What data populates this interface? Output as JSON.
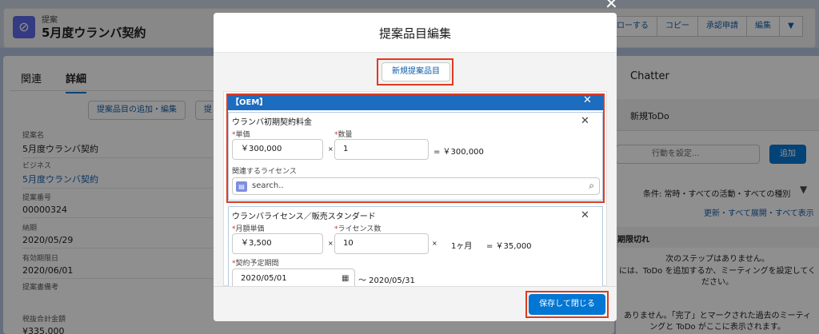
{
  "background": {
    "record_type": "提案",
    "record_name": "5月度ウランバ契約",
    "header_buttons": [
      "ローする",
      "コピー",
      "承認申請",
      "編集",
      "▼"
    ],
    "tabs": [
      "関連",
      "詳細"
    ],
    "action_button": "提案品目の追加・編集",
    "action_button2": "提",
    "fields": [
      {
        "label": "提案名",
        "value": "5月度ウランバ契約",
        "link": false
      },
      {
        "label": "ビジネス",
        "value": "5月度ウランバ契約",
        "link": true
      },
      {
        "label": "提案番号",
        "value": "00000324",
        "link": false
      },
      {
        "label": "納期",
        "value": "2020/05/29",
        "link": false
      },
      {
        "label": "有効期限日",
        "value": "2020/06/01",
        "link": false
      },
      {
        "label": "提案書備考",
        "value": "",
        "link": false
      },
      {
        "label": "税抜合計金額",
        "value": "¥335,000",
        "link": false
      }
    ],
    "chatter": {
      "title": "Chatter",
      "todo_tab": "新規ToDo",
      "activity_placeholder": "行動を設定...",
      "add_label": "追加",
      "filter_text": "条件: 常時・すべての活動・すべての種別",
      "refresh_links": "更新・すべて展開・すべて表示",
      "overdue_title": "期限切れ",
      "no_steps_1": "次のステップはありません。",
      "no_steps_2": "には、ToDo を追加するか、ミーティングを設定してく",
      "no_steps_3": "ださい。",
      "past_1": "ありません。「完了」とマークされた過去のミーティ",
      "past_2": "ングと ToDo がここに表示されます。"
    }
  },
  "modal": {
    "title": "提案品目編集",
    "new_item_button": "新規提案品目",
    "group_header": "【OEM】",
    "items": [
      {
        "title": "ウランバ初期契約料金",
        "unit_price_label": "単価",
        "unit_price": "￥300,000",
        "times": "×",
        "qty_label": "数量",
        "qty": "1",
        "subtotal": "= ￥300,000",
        "related_license_label": "関連するライセンス",
        "search_placeholder": "search.."
      },
      {
        "title": "ウランバライセンス／販売スタンダード",
        "monthly_label": "月額単価",
        "monthly_price": "￥3,500",
        "times": "×",
        "license_count_label": "ライセンス数",
        "license_count": "10",
        "times2": "×",
        "months": "1ヶ月",
        "subtotal": "= ￥35,000",
        "period_label": "契約予定期間",
        "start_date": "2020/05/01",
        "end_date": "〜 2020/05/31"
      }
    ],
    "save_button": "保存して閉じる"
  }
}
